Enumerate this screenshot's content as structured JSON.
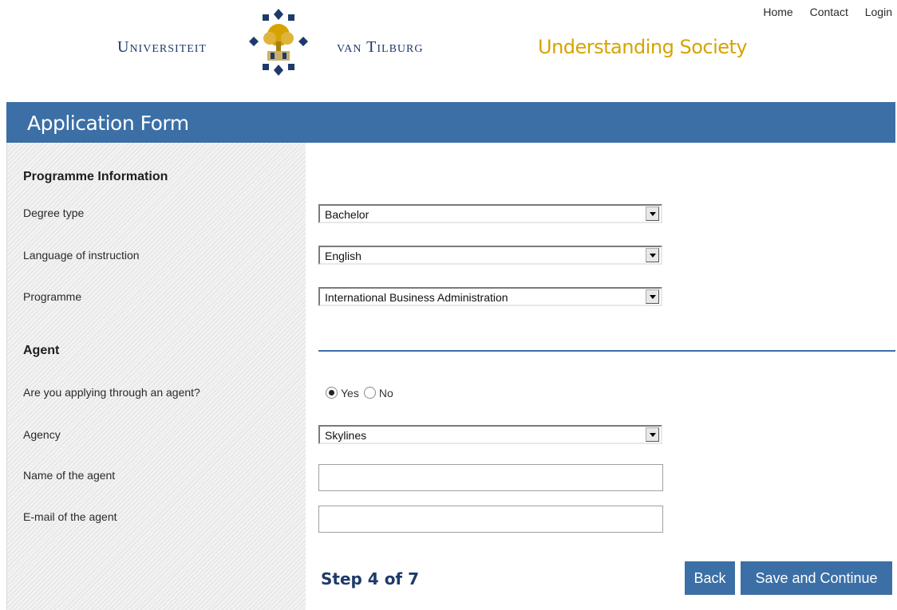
{
  "nav": {
    "home": "Home",
    "contact": "Contact",
    "login": "Login"
  },
  "logo": {
    "word_left": "Universiteit",
    "word_right": "van Tilburg",
    "tagline": "Understanding Society"
  },
  "form": {
    "title": "Application Form",
    "programme_section": {
      "heading": "Programme Information",
      "degree_type": {
        "label": "Degree type",
        "value": "Bachelor"
      },
      "language": {
        "label": "Language of instruction",
        "value": "English"
      },
      "programme": {
        "label": "Programme",
        "value": "International Business Administration"
      }
    },
    "agent_section": {
      "heading": "Agent",
      "applying_question": "Are you applying through an agent?",
      "yes_label": "Yes",
      "no_label": "No",
      "selected": "Yes",
      "agency": {
        "label": "Agency",
        "value": "Skylines"
      },
      "agent_name": {
        "label": "Name of the agent",
        "value": ""
      },
      "agent_email": {
        "label": "E-mail of the agent",
        "value": ""
      }
    },
    "step": "Step 4 of 7",
    "back_label": "Back",
    "save_label": "Save and Continue"
  },
  "colors": {
    "primary": "#3b6fa6",
    "tagline": "#d6a300",
    "navy": "#1d3a6b"
  }
}
